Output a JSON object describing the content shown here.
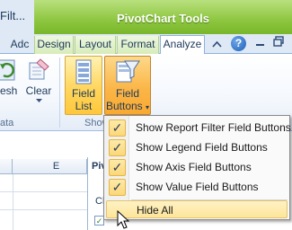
{
  "window": {
    "title_fragment": "Filt..."
  },
  "ribbon_context": {
    "banner": "PivotChart Tools"
  },
  "tabs": [
    {
      "label": "Adc"
    },
    {
      "label": "Design"
    },
    {
      "label": "Layout"
    },
    {
      "label": "Format"
    },
    {
      "label": "Analyze"
    }
  ],
  "help": {
    "label": "?"
  },
  "ribbon": {
    "refresh_label": "esh",
    "clear_label": "Clear",
    "group_label_left": "ata",
    "field_list_label": [
      "Field",
      "List"
    ],
    "field_buttons_label": [
      "Field",
      "Buttons"
    ],
    "group_label_show": "Show"
  },
  "sheet": {
    "col_e": "E",
    "pivot_header": "Piv",
    "chart_label": "Ch"
  },
  "menu": {
    "items": [
      {
        "label": "Show Report Filter Field Buttons",
        "checked": true,
        "check": "✓"
      },
      {
        "label": "Show Legend Field Buttons",
        "checked": true,
        "check": "✓"
      },
      {
        "label": "Show Axis Field Buttons",
        "checked": true,
        "check": "✓"
      },
      {
        "label": "Show Value Field Buttons",
        "checked": true,
        "check": "✓"
      },
      {
        "label": "Hide All",
        "checked": false
      }
    ]
  },
  "colors": {
    "accent_green": "#8dc63f",
    "highlight": "#ffd65d",
    "ribbon_blue": "#dfe9f5"
  }
}
